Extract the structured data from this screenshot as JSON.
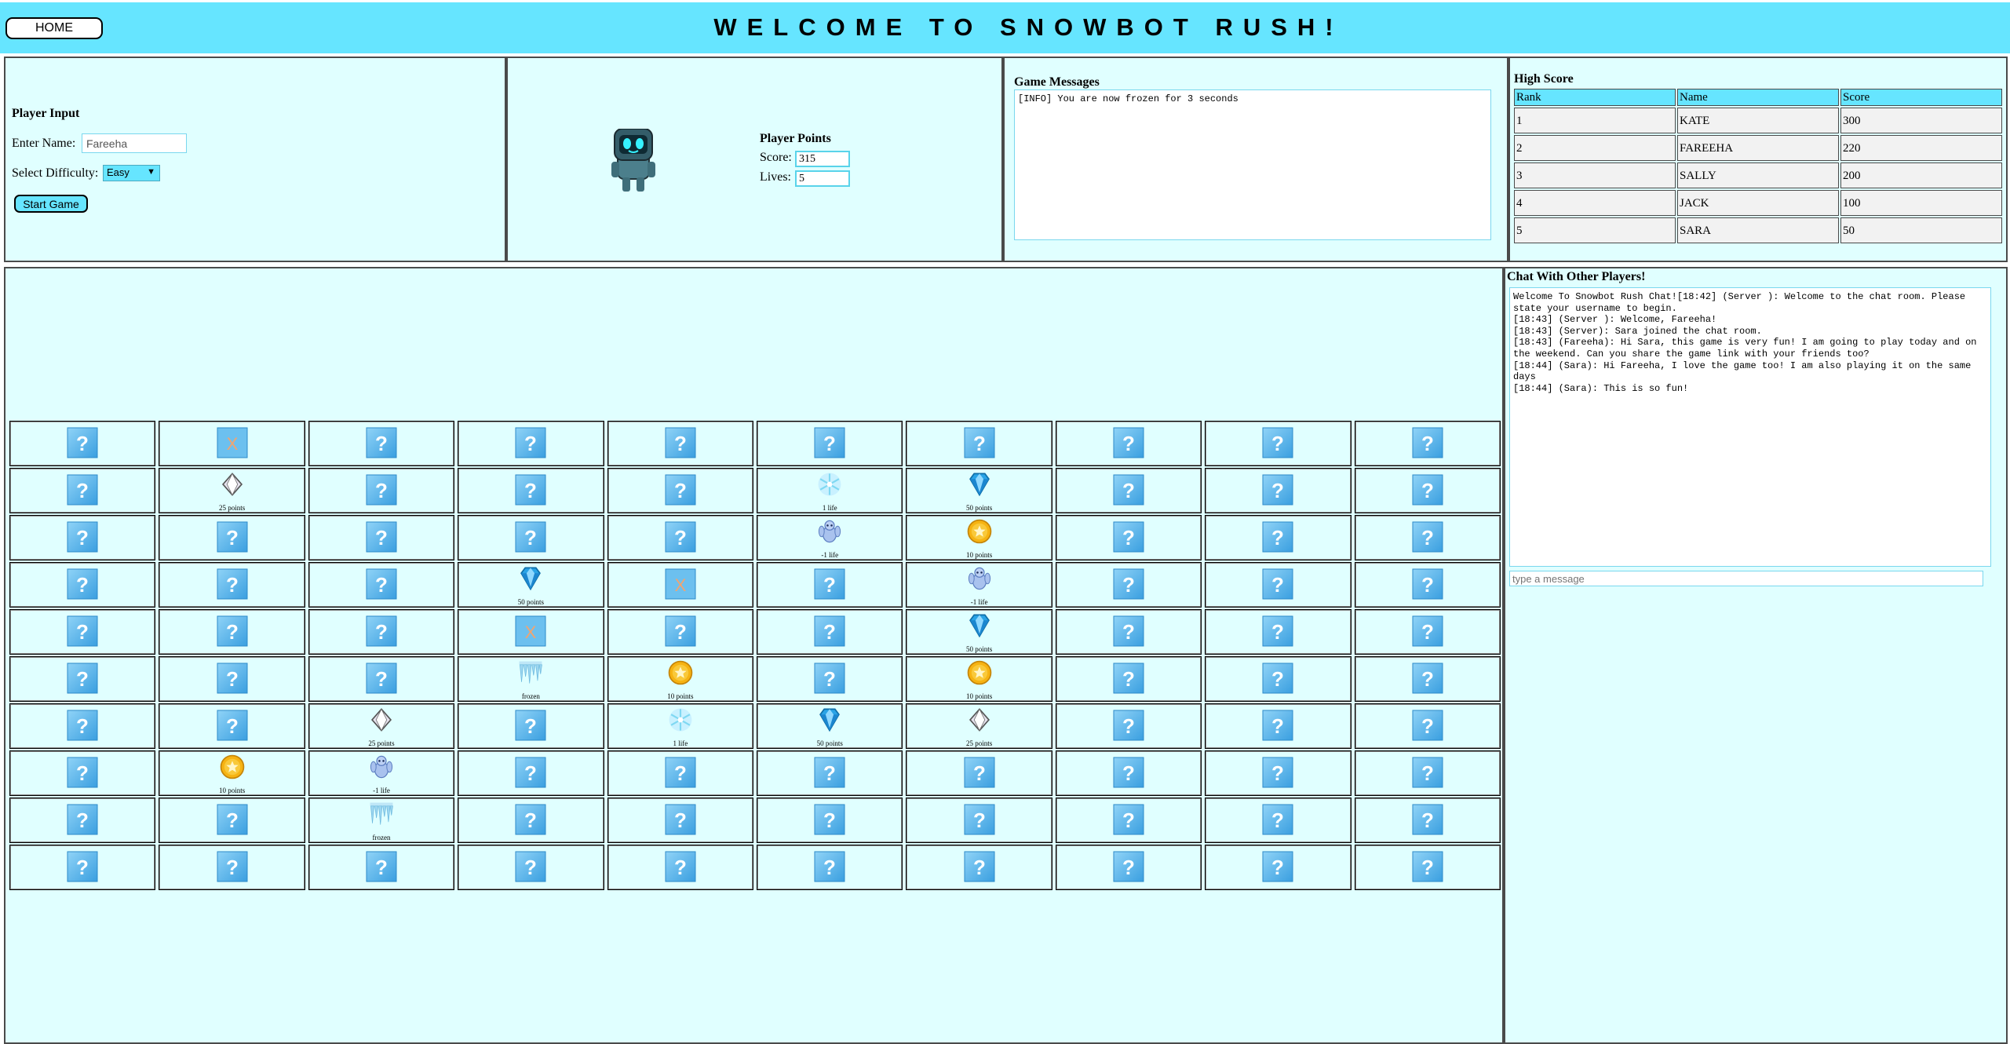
{
  "header": {
    "home_label": "HOME",
    "title": "WELCOME TO SNOWBOT RUSH!"
  },
  "player_input": {
    "heading": "Player Input",
    "name_label": "Enter Name:",
    "name_value": "Fareeha",
    "difficulty_label": "Select Difficulty:",
    "difficulty_value": "Easy",
    "start_label": "Start Game"
  },
  "player_points": {
    "heading": "Player Points",
    "score_label": "Score:",
    "score_value": "315",
    "lives_label": "Lives:",
    "lives_value": "5"
  },
  "game_messages": {
    "heading": "Game Messages",
    "text": "[INFO] You are now frozen for 3 seconds"
  },
  "high_score": {
    "heading": "High Score",
    "columns": [
      "Rank",
      "Name",
      "Score"
    ],
    "rows": [
      [
        "1",
        "KATE",
        "300"
      ],
      [
        "2",
        "FAREEHA",
        "220"
      ],
      [
        "3",
        "SALLY",
        "200"
      ],
      [
        "4",
        "JACK",
        "100"
      ],
      [
        "5",
        "SARA",
        "50"
      ]
    ]
  },
  "board": {
    "rows": [
      [
        "hidden",
        "used",
        "hidden",
        "hidden",
        "hidden",
        "hidden",
        "hidden",
        "hidden",
        "hidden",
        "hidden"
      ],
      [
        "hidden",
        "crystal",
        "hidden",
        "hidden",
        "hidden",
        "snowflake",
        "diamond",
        "hidden",
        "hidden",
        "hidden"
      ],
      [
        "hidden",
        "hidden",
        "hidden",
        "hidden",
        "hidden",
        "yeti",
        "coin",
        "hidden",
        "hidden",
        "hidden"
      ],
      [
        "hidden",
        "hidden",
        "hidden",
        "diamond",
        "used",
        "hidden",
        "yeti",
        "hidden",
        "hidden",
        "hidden"
      ],
      [
        "hidden",
        "hidden",
        "hidden",
        "used",
        "hidden",
        "hidden",
        "diamond",
        "hidden",
        "hidden",
        "hidden"
      ],
      [
        "hidden",
        "hidden",
        "hidden",
        "icicle",
        "coin",
        "hidden",
        "coin",
        "hidden",
        "hidden",
        "hidden"
      ],
      [
        "hidden",
        "hidden",
        "crystal",
        "hidden",
        "snowflake",
        "diamond",
        "crystal",
        "hidden",
        "hidden",
        "hidden"
      ],
      [
        "hidden",
        "coin",
        "yeti",
        "hidden",
        "hidden",
        "hidden",
        "hidden",
        "hidden",
        "hidden",
        "hidden"
      ],
      [
        "hidden",
        "hidden",
        "icicle",
        "hidden",
        "hidden",
        "hidden",
        "hidden",
        "hidden",
        "hidden",
        "hidden"
      ],
      [
        "hidden",
        "hidden",
        "hidden",
        "hidden",
        "hidden",
        "hidden",
        "hidden",
        "hidden",
        "hidden",
        "hidden"
      ]
    ],
    "labels": {
      "crystal": "25 points",
      "diamond": "50 points",
      "coin": "10 points",
      "snowflake": "1 life",
      "yeti": "-1 life",
      "icicle": "frozen"
    }
  },
  "chat": {
    "heading": "Chat With Other Players!",
    "lines": [
      "Welcome To Snowbot Rush Chat![18:42] (Server ): Welcome to the chat room. Please state your username to begin.",
      "[18:43] (Server ): Welcome, Fareeha!",
      "[18:43] (Server): Sara joined the chat room.",
      "[18:43] (Fareeha): Hi Sara, this game is very fun! I am going to play today and on the weekend. Can you share the game link with your friends too?",
      "[18:44] (Sara): Hi Fareeha, I love the game too! I am also playing it on the same days",
      "[18:44] (Sara): This is so fun!"
    ],
    "input_placeholder": "type a message"
  },
  "colors": {
    "header_bg": "#66e5ff",
    "panel_bg": "#e0ffff",
    "tile_blue": "#4fb4ea"
  }
}
